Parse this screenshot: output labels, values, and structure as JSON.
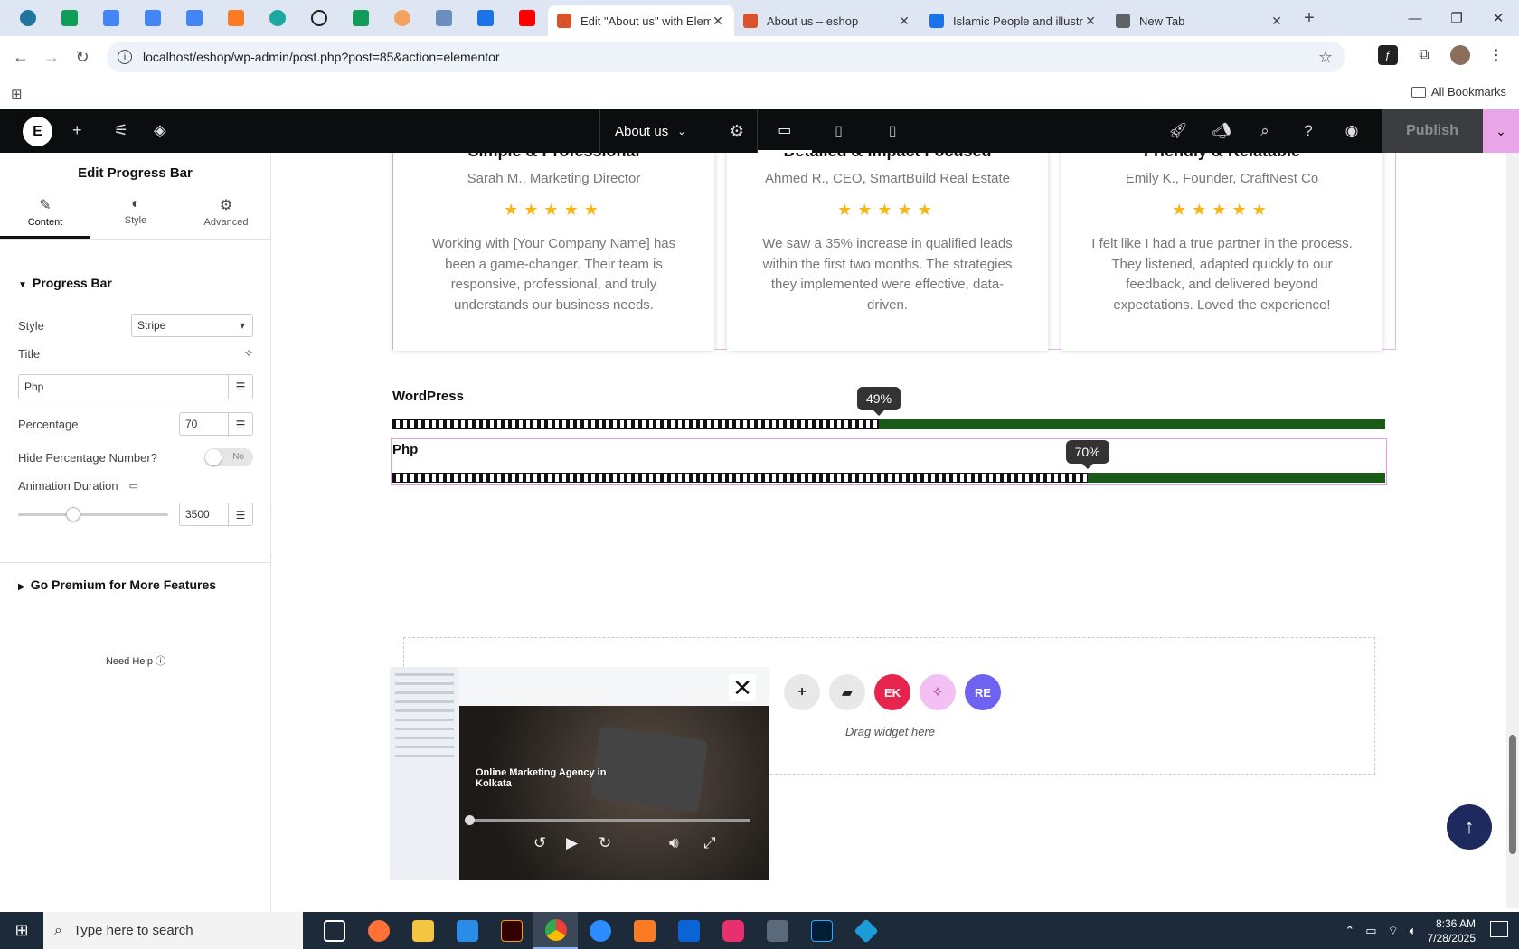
{
  "browser": {
    "tabs": [
      {
        "title": "Edit \"About us\" with Elementor",
        "active": true,
        "color": "#d9532a"
      },
      {
        "title": "About us – eshop",
        "active": false,
        "color": "#d9532a"
      },
      {
        "title": "Islamic People and illustrations",
        "active": false,
        "color": "#1a73e8"
      },
      {
        "title": "New Tab",
        "active": false,
        "color": "#5f6368"
      }
    ],
    "url": "localhost/eshop/wp-admin/post.php?post=85&action=elementor",
    "bookmarks_label": "All Bookmarks"
  },
  "elementor": {
    "page_name": "About us",
    "publish_label": "Publish"
  },
  "panel": {
    "title": "Edit Progress Bar",
    "tabs": [
      {
        "label": "Content",
        "icon": "pencil-icon"
      },
      {
        "label": "Style",
        "icon": "half-circle-icon"
      },
      {
        "label": "Advanced",
        "icon": "gear-icon"
      }
    ],
    "section": "Progress Bar",
    "style_label": "Style",
    "style_value": "Stripe",
    "title_label": "Title",
    "title_value": "Php",
    "percentage_label": "Percentage",
    "percentage_value": "70",
    "hide_label": "Hide Percentage Number?",
    "hide_value": "No",
    "anim_label": "Animation Duration",
    "anim_value": "3500",
    "anim_slider_fraction": 0.35,
    "premium_label": "Go Premium for More Features",
    "help_label": "Need Help"
  },
  "testimonials": [
    {
      "title": "Simple & Professional",
      "name": "Sarah M., Marketing Director",
      "quote": "Working with [Your Company Name] has been a game-changer. Their team is responsive, professional, and truly understands our business needs."
    },
    {
      "title": "Detailed & Impact Focused",
      "name": "Ahmed R., CEO, SmartBuild Real Estate",
      "quote": "We saw a 35% increase in qualified leads within the first two months. The strategies they implemented were effective, data-driven."
    },
    {
      "title": "Friendly & Relatable",
      "name": "Emily K., Founder, CraftNest Co",
      "quote": "I felt like I had a true partner in the process. They listened, adapted quickly to our feedback, and delivered beyond expectations. Loved the experience!"
    }
  ],
  "progress_bars": [
    {
      "title": "WordPress",
      "percent": 49,
      "label": "49%"
    },
    {
      "title": "Php",
      "percent": 70,
      "label": "70%"
    }
  ],
  "dropzone_text": "Drag widget here",
  "video": {
    "title": "Online Marketing Agency in Kolkata",
    "progress_fraction": 0.0
  },
  "taskbar": {
    "search_placeholder": "Type here to search",
    "time": "8:36 AM",
    "date": "7/28/2025"
  }
}
